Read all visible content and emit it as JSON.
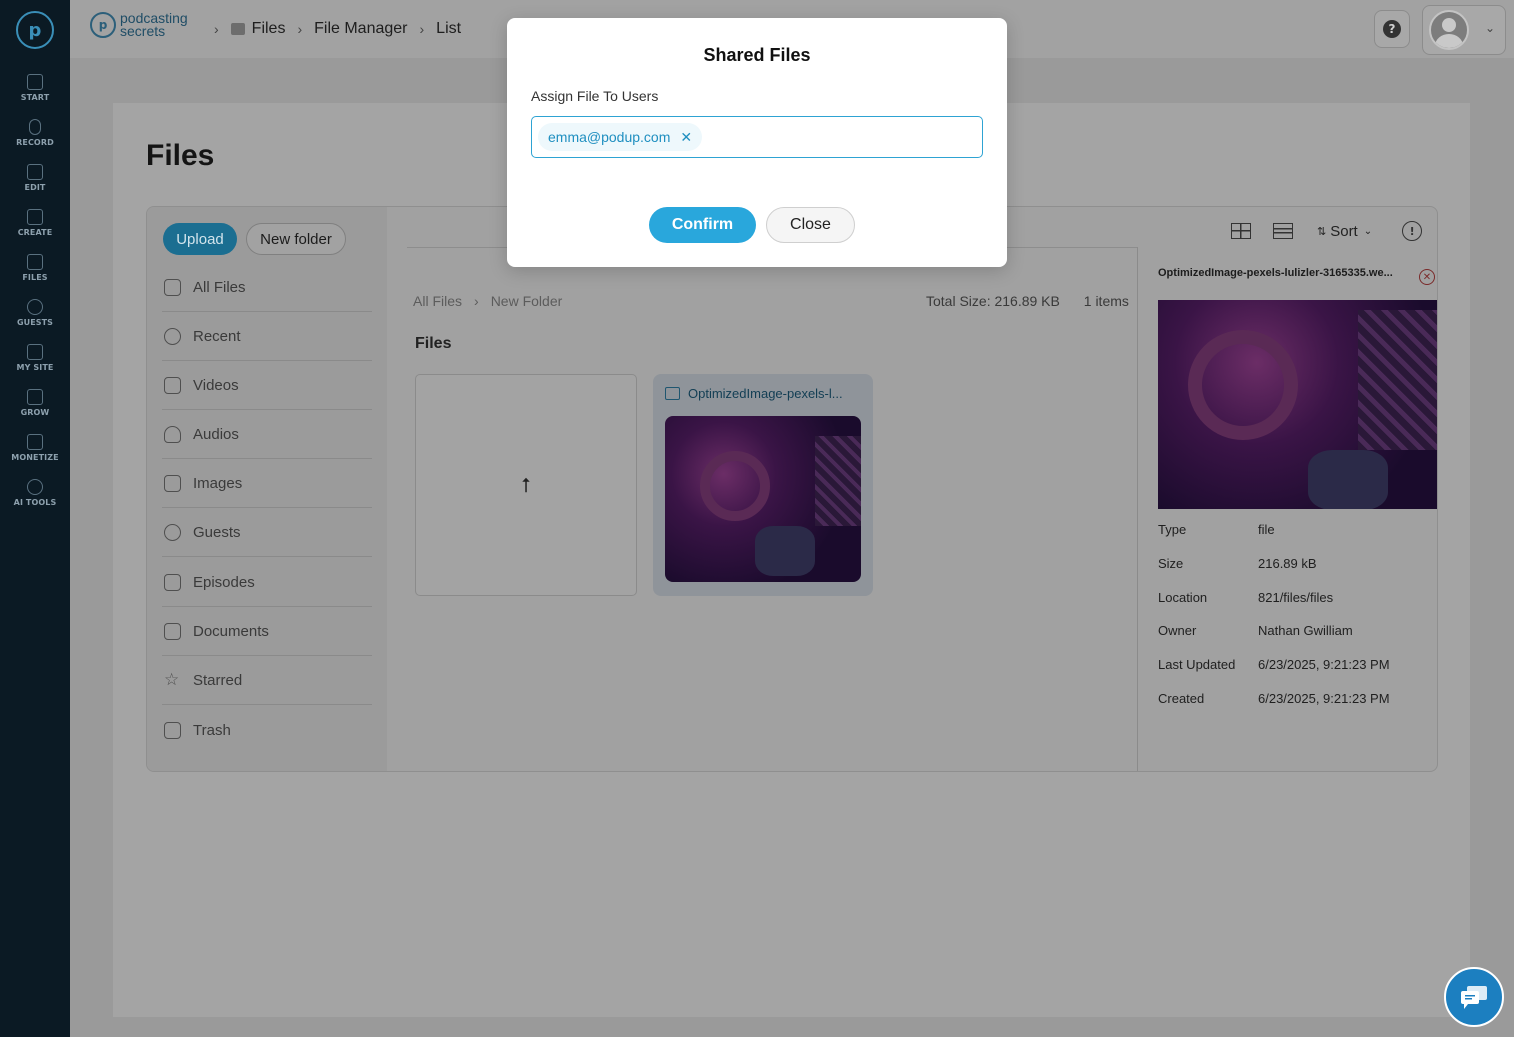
{
  "nav": {
    "items": [
      {
        "label": "START",
        "icon": "start-icon"
      },
      {
        "label": "RECORD",
        "icon": "microphone-icon"
      },
      {
        "label": "EDIT",
        "icon": "edit-icon"
      },
      {
        "label": "CREATE",
        "icon": "create-icon"
      },
      {
        "label": "FILES",
        "icon": "files-icon"
      },
      {
        "label": "GUESTS",
        "icon": "guests-icon"
      },
      {
        "label": "MY SITE",
        "icon": "site-icon"
      },
      {
        "label": "GROW",
        "icon": "grow-icon"
      },
      {
        "label": "MONETIZE",
        "icon": "monetize-icon"
      },
      {
        "label": "AI TOOLS",
        "icon": "ai-tools-icon"
      }
    ]
  },
  "brand": {
    "line1": "podcasting",
    "line2": "secrets"
  },
  "breadcrumb": [
    "Files",
    "File Manager",
    "List"
  ],
  "page": {
    "title": "Files"
  },
  "sidebar": {
    "upload_label": "Upload",
    "new_folder_label": "New folder",
    "items": [
      {
        "label": "All Files",
        "icon": "all-files-icon"
      },
      {
        "label": "Recent",
        "icon": "clock-icon"
      },
      {
        "label": "Videos",
        "icon": "video-icon"
      },
      {
        "label": "Audios",
        "icon": "music-icon"
      },
      {
        "label": "Images",
        "icon": "image-icon"
      },
      {
        "label": "Guests",
        "icon": "users-icon"
      },
      {
        "label": "Episodes",
        "icon": "episode-icon"
      },
      {
        "label": "Documents",
        "icon": "document-icon"
      },
      {
        "label": "Starred",
        "icon": "star-icon"
      },
      {
        "label": "Trash",
        "icon": "trash-icon"
      }
    ]
  },
  "toolbar": {
    "sort_label": "Sort"
  },
  "folder_path": [
    "All Files",
    "New Folder"
  ],
  "totals": {
    "size": "Total Size: 216.89 KB",
    "items": "1 items"
  },
  "files_heading": "Files",
  "file": {
    "name_short": "OptimizedImage-pexels-l..."
  },
  "details": {
    "name": "OptimizedImage-pexels-lulizler-3165335.we...",
    "rows": [
      {
        "key": "Type",
        "value": "file"
      },
      {
        "key": "Size",
        "value": "216.89 kB"
      },
      {
        "key": "Location",
        "value": "821/files/files"
      },
      {
        "key": "Owner",
        "value": "Nathan Gwilliam"
      },
      {
        "key": "Last Updated",
        "value": "6/23/2025, 9:21:23 PM"
      },
      {
        "key": "Created",
        "value": "6/23/2025, 9:21:23 PM"
      }
    ]
  },
  "modal": {
    "title": "Shared Files",
    "label": "Assign File To Users",
    "tags": [
      "emma@podup.com"
    ],
    "confirm_label": "Confirm",
    "close_label": "Close"
  },
  "colors": {
    "accent": "#29a7dc",
    "nav_bg": "#0b1a24"
  }
}
